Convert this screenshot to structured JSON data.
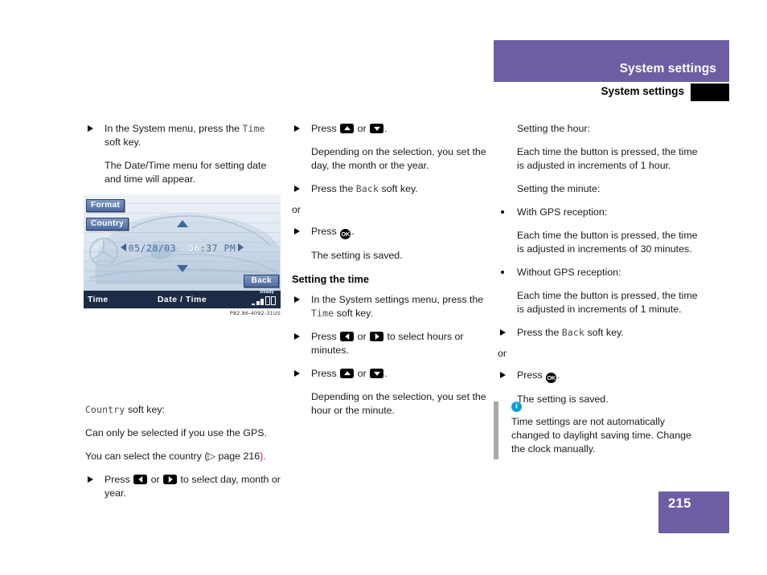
{
  "header": {
    "title": "System settings",
    "subtitle": "System settings"
  },
  "footer": {
    "page_number": "215"
  },
  "caption": {
    "figure_id": "P82.86-4092-31US"
  },
  "device_screen": {
    "softkeys": {
      "format": "Format",
      "country": "Country",
      "back": "Back"
    },
    "date_value": "05/28/03",
    "time_hour": "06",
    "time_rest": ":37 PM",
    "status_left": "Time",
    "status_center": "Date / Time",
    "status_ready": "Ready"
  },
  "left_column": {
    "step1_a": "In the System menu, press the ",
    "step1_key": "Time",
    "step1_b": " soft key.",
    "step1_note": "The Date/Time menu for setting date and time will appear.",
    "country_key": "Country",
    "country_title_rest": " soft key:",
    "country_line1": "Can only be selected if you use the GPS.",
    "country_line2_a": "You can select the country (",
    "country_line2_ref": "page 216",
    "country_line2_b": ").",
    "step2_a": "Press ",
    "step2_mid": " or ",
    "step2_b": " to select day, month or year."
  },
  "mid_column": {
    "step1_a": "Press ",
    "step1_mid": " or ",
    "step1_b": ".",
    "step1_note": "Depending on the selection, you set the day, the month or the year.",
    "step2_a": "Press the ",
    "step2_key": "Back",
    "step2_b": " soft key.",
    "or_label": "or",
    "step3_a": "Press ",
    "step3_b": ".",
    "step3_note": "The setting is saved.",
    "section_title": "Setting the time",
    "step4_a": "In the System settings menu, press the ",
    "step4_key": "Time",
    "step4_b": " soft key.",
    "step5_a": "Press ",
    "step5_mid": " or ",
    "step5_b": " to select hours or minutes.",
    "step6_a": "Press ",
    "step6_mid": " or ",
    "step6_b": ".",
    "step6_note": "Depending on the selection, you set the hour or the minute."
  },
  "right_column": {
    "hour_title": "Setting the hour:",
    "hour_text": "Each time the button is pressed, the time is adjusted in increments of 1 hour.",
    "minute_title": "Setting the minute:",
    "gps_with_title": "With GPS reception:",
    "gps_with_text": "Each time the button is pressed, the time is adjusted in increments of 30 minutes.",
    "gps_without_title": "Without GPS reception:",
    "gps_without_text": "Each time the button is pressed, the time is adjusted in increments of 1 minute.",
    "step_back_a": "Press the ",
    "step_back_key": "Back",
    "step_back_b": " soft key.",
    "or_label": "or",
    "step_ok_a": "Press ",
    "step_ok_b": ".",
    "step_ok_note": "The setting is saved."
  },
  "note": {
    "icon": "info-icon",
    "text": "Time settings are not automatically changed to daylight saving time. Change the clock manually."
  },
  "icons": {
    "ok_label": "OK"
  },
  "colors": {
    "accent_purple": "#6d5ea3",
    "info_blue": "#0a9de0",
    "reference_magenta": "#d6007f",
    "screen_dark": "#1d2b47"
  }
}
